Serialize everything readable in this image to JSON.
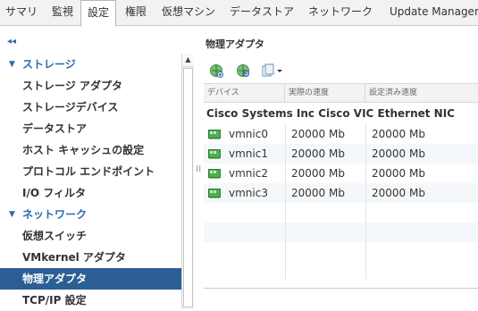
{
  "tabs": [
    {
      "label": "サマリ",
      "active": false
    },
    {
      "label": "監視",
      "active": false
    },
    {
      "label": "設定",
      "active": true
    },
    {
      "label": "権限",
      "active": false
    },
    {
      "label": "仮想マシン",
      "active": false
    },
    {
      "label": "データストア",
      "active": false
    },
    {
      "label": "ネットワーク",
      "active": false
    },
    {
      "label": "Update Manager",
      "active": false
    }
  ],
  "nav": {
    "collapse_glyph": "◂◂",
    "groups": [
      {
        "label": "ストレージ",
        "items": [
          "ストレージ アダプタ",
          "ストレージデバイス",
          "データストア",
          "ホスト キャッシュの設定",
          "プロトコル エンドポイント",
          "I/O フィルタ"
        ]
      },
      {
        "label": "ネットワーク",
        "items": [
          "仮想スイッチ",
          "VMkernel アダプタ",
          "物理アダプタ",
          "TCP/IP 設定"
        ]
      }
    ],
    "selected": "物理アダプタ"
  },
  "content": {
    "title": "物理アダプタ",
    "toolbar_icons": [
      "add-network-icon",
      "refresh-network-icon",
      "document-menu-icon"
    ],
    "columns": [
      "デバイス",
      "実際の速度",
      "設定済み速度"
    ],
    "group_label": "Cisco Systems Inc Cisco VIC Ethernet NIC",
    "rows": [
      {
        "device": "vmnic0",
        "actual": "20000 Mb",
        "configured": "20000 Mb"
      },
      {
        "device": "vmnic1",
        "actual": "20000 Mb",
        "configured": "20000 Mb"
      },
      {
        "device": "vmnic2",
        "actual": "20000 Mb",
        "configured": "20000 Mb"
      },
      {
        "device": "vmnic3",
        "actual": "20000 Mb",
        "configured": "20000 Mb"
      }
    ]
  },
  "colors": {
    "accent": "#2a6bb0",
    "selected_bg": "#2b5f94",
    "nic_green": "#3a9a3a"
  }
}
